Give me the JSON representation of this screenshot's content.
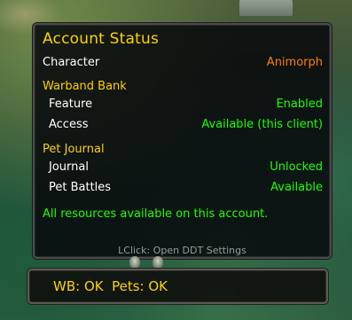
{
  "tooltip": {
    "title": "Account Status",
    "character": {
      "label": "Character",
      "value": "Animorph"
    },
    "warband_bank": {
      "heading": "Warband Bank",
      "rows": [
        {
          "label": "Feature",
          "value": "Enabled"
        },
        {
          "label": "Access",
          "value": "Available (this client)"
        }
      ]
    },
    "pet_journal": {
      "heading": "Pet Journal",
      "rows": [
        {
          "label": "Journal",
          "value": "Unlocked"
        },
        {
          "label": "Pet Battles",
          "value": "Available"
        }
      ]
    },
    "summary": "All resources available on this account.",
    "hint": "LClick: Open DDT Settings"
  },
  "broker": {
    "text": "WB: OK  Pets: OK"
  },
  "colors": {
    "title_gold": "#ffd100",
    "status_green": "#1eff00",
    "class_orange": "#ff7d0a",
    "hint_gray": "#9a9a9a"
  }
}
